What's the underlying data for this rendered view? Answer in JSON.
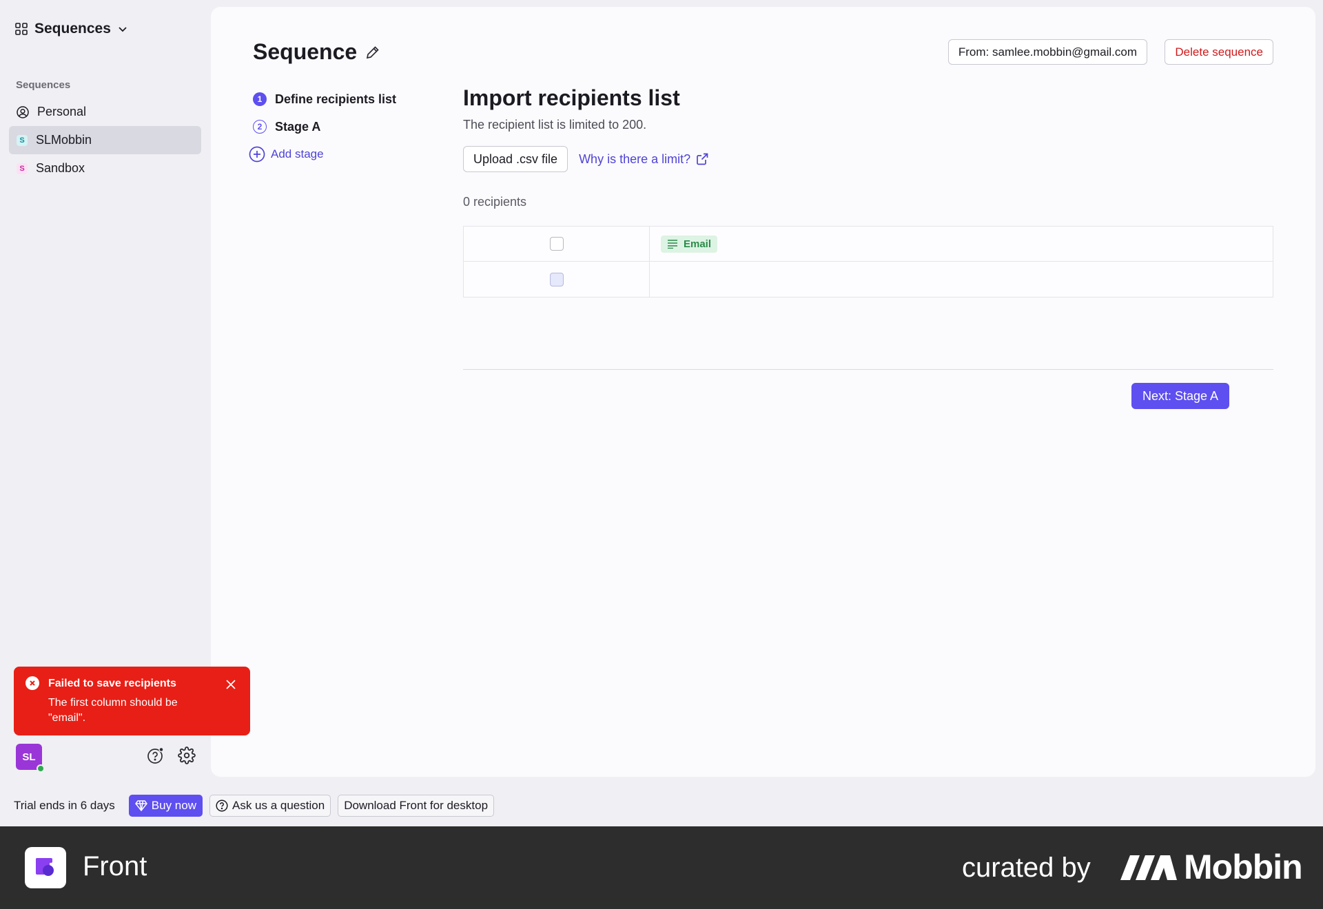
{
  "sidebar": {
    "app_switcher_label": "Sequences",
    "section_label": "Sequences",
    "items": [
      {
        "label": "Personal",
        "badge": ""
      },
      {
        "label": "SLMobbin",
        "badge": "S"
      },
      {
        "label": "Sandbox",
        "badge": "S"
      }
    ],
    "avatar_initials": "SL"
  },
  "toast": {
    "title": "Failed to save recipients",
    "body": "The first column should be \"email\"."
  },
  "header": {
    "title": "Sequence",
    "from_label": "From: samlee.mobbin@gmail.com",
    "delete_label": "Delete sequence"
  },
  "steps": [
    {
      "num": "1",
      "label": "Define recipients list"
    },
    {
      "num": "2",
      "label": "Stage A"
    }
  ],
  "add_stage_label": "Add stage",
  "import": {
    "title": "Import recipients list",
    "subtitle": "The recipient list is limited to 200.",
    "upload_label": "Upload .csv file",
    "limit_link": "Why is there a limit?",
    "count": "0 recipients",
    "column_email": "Email"
  },
  "next_label": "Next: Stage A",
  "trial": {
    "text": "Trial ends in 6 days",
    "buy": "Buy now",
    "ask": "Ask us a question",
    "download": "Download Front for desktop"
  },
  "footer": {
    "app_name": "Front",
    "curated": "curated by",
    "brand": "Mobbin"
  },
  "colors": {
    "accent": "#5e4ff0",
    "error": "#e81f16",
    "footer_bg": "#2d2d2d"
  }
}
